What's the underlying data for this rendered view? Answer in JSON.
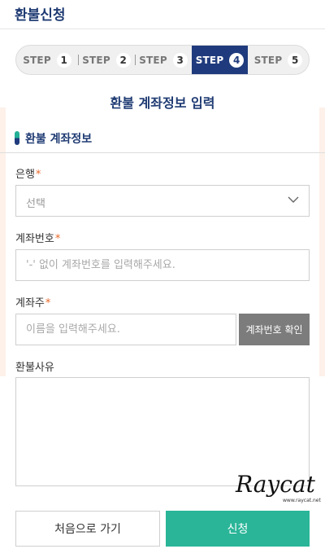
{
  "header": {
    "title": "환불신청"
  },
  "steps": [
    {
      "label": "STEP",
      "num": "1",
      "active": false
    },
    {
      "label": "STEP",
      "num": "2",
      "active": false
    },
    {
      "label": "STEP",
      "num": "3",
      "active": false
    },
    {
      "label": "STEP",
      "num": "4",
      "active": true
    },
    {
      "label": "STEP",
      "num": "5",
      "active": false
    }
  ],
  "page": {
    "title": "환불 계좌정보 입력"
  },
  "section": {
    "title": "환불 계좌정보"
  },
  "form": {
    "bank": {
      "label": "은행",
      "required_mark": "*",
      "value": "선택"
    },
    "account_number": {
      "label": "계좌번호",
      "required_mark": "*",
      "placeholder": "'-' 없이 계좌번호를 입력해주세요."
    },
    "account_holder": {
      "label": "계좌주",
      "required_mark": "*",
      "placeholder": "이름을 입력해주세요.",
      "verify_label": "계좌번호 확인"
    },
    "reason": {
      "label": "환불사유",
      "value": ""
    }
  },
  "actions": {
    "reset_label": "처음으로 가기",
    "submit_label": "신청"
  },
  "watermark": {
    "brand": "Raycat",
    "site": "www.raycat.net"
  },
  "colors": {
    "navy": "#1f3b7d",
    "teal": "#2ab598",
    "required": "#e8682a",
    "gray_button": "#7c7c7c"
  }
}
